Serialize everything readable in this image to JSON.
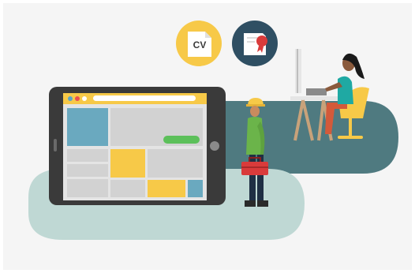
{
  "badges": {
    "cv": {
      "label": "CV",
      "icon": "cv-document-icon",
      "color": "#f7c948"
    },
    "certificate": {
      "icon": "certificate-ribbon-icon",
      "color": "#2f4f63"
    }
  },
  "tablet": {
    "frame_color": "#3a3a3a",
    "toolbar_color": "#f7c948",
    "button_color": "#5cc05a",
    "dots": [
      "#5aa5c8",
      "#ea4f4f",
      "#f7c948"
    ]
  },
  "colors": {
    "background": "#f5f5f5",
    "teal_blob": "#4f7a80",
    "mint_blob": "#bfd8d4",
    "accent_yellow": "#f7c948",
    "accent_blue": "#6aa9bf",
    "accent_red": "#d93b3b"
  },
  "people": {
    "worker": {
      "icon": "construction-worker-icon"
    },
    "designer": {
      "icon": "woman-at-computer-icon"
    }
  }
}
